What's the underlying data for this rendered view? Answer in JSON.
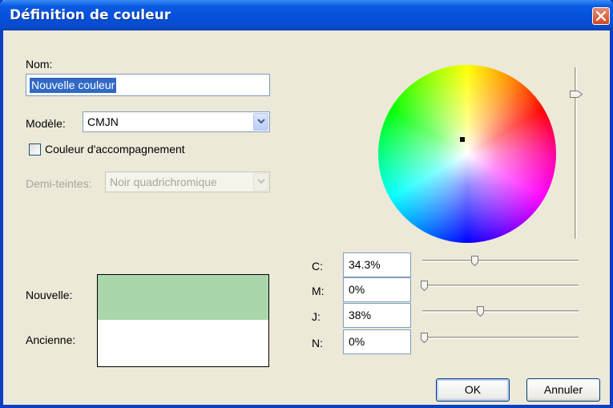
{
  "window": {
    "title": "Définition de couleur",
    "close_icon": "close-icon"
  },
  "form": {
    "name_label": "Nom:",
    "name_value": "Nouvelle couleur",
    "model_label": "Modèle:",
    "model_value": "CMJN",
    "spot_label": "Couleur d'accompagnement",
    "spot_checked": false,
    "halftone_label": "Demi-teintes:",
    "halftone_value": "Noir quadrichromique"
  },
  "preview": {
    "new_label": "Nouvelle:",
    "old_label": "Ancienne:",
    "new_color": "#aad6ab",
    "old_color": "#ffffff"
  },
  "channels": [
    {
      "label": "C:",
      "value": "34.3%",
      "fraction": 0.343
    },
    {
      "label": "M:",
      "value": "0%",
      "fraction": 0.0
    },
    {
      "label": "J:",
      "value": "38%",
      "fraction": 0.38
    },
    {
      "label": "N:",
      "value": "0%",
      "fraction": 0.0
    }
  ],
  "brightness_fraction": 0.86,
  "buttons": {
    "ok": "OK",
    "cancel": "Annuler"
  },
  "colors": {
    "title_bar": "#0a5be0",
    "selection": "#316ac5",
    "dialog_bg": "#ece9d8"
  }
}
